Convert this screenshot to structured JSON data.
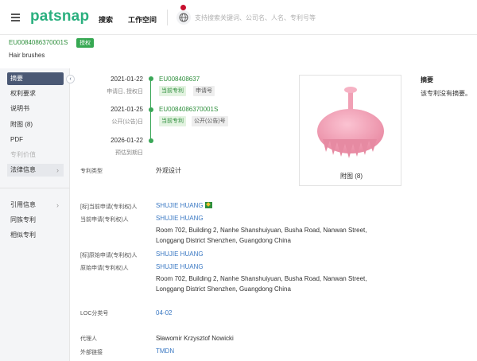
{
  "topbar": {
    "logo": "patsnap",
    "nav": [
      "搜索",
      "工作空间"
    ],
    "search_placeholder": "支持搜索关键词、公司名、人名、专利号等"
  },
  "header": {
    "pub_number": "EU008408637000​1S",
    "status_badge": "授权",
    "title": "Hair brushes"
  },
  "sidebar": {
    "items": [
      {
        "label": "摘要",
        "state": "active"
      },
      {
        "label": "权利要求"
      },
      {
        "label": "说明书"
      },
      {
        "label": "附图 (8)"
      },
      {
        "label": "PDF"
      },
      {
        "label": "专利价值",
        "state": "muted"
      },
      {
        "label": "法律信息",
        "state": "hover"
      }
    ],
    "items2": [
      {
        "label": "引用信息"
      },
      {
        "label": "同族专利"
      },
      {
        "label": "相似专利"
      }
    ]
  },
  "timeline": [
    {
      "date": "2021-01-22",
      "sub": "申请日, 授权日",
      "link": "EU008408637",
      "chips": [
        "当前专利",
        "申请号"
      ]
    },
    {
      "date": "2021-01-25",
      "sub": "公开(公告)日",
      "link": "EU0084086370001S",
      "chips": [
        "当前专利",
        "公开(公告)号"
      ]
    },
    {
      "date": "2026-01-22",
      "sub": "预估到期日"
    }
  ],
  "figure": {
    "label": "附图 (8)",
    "color": "#f2a4b8"
  },
  "abstract": {
    "title": "摘要",
    "text": "该专利没有摘要。"
  },
  "fields": {
    "patent_type": {
      "label": "专利类型",
      "value": "外观设计"
    },
    "std_current_assignee": {
      "label": "[标]当前申请(专利权)人",
      "value": "SHUJIE HUANG"
    },
    "current_assignee": {
      "label": "当前申请(专利权)人",
      "value": "SHUJIE HUANG",
      "addr1": "Room 702, Building 2, Nanhe Shanshuiyuan, Busha Road, Nanwan Street,",
      "addr2": "Longgang District Shenzhen, Guangdong China"
    },
    "std_original_assignee": {
      "label": "[标]原始申请(专利权)人",
      "value": "SHUJIE HUANG"
    },
    "original_assignee": {
      "label": "原始申请(专利权)人",
      "value": "SHUJIE HUANG",
      "addr1": "Room 702, Building 2, Nanhe Shanshuiyuan, Busha Road, Nanwan Street,",
      "addr2": "Longgang District Shenzhen, Guangdong China"
    },
    "loc": {
      "label": "LOC分类号",
      "value": "04-02"
    },
    "agent": {
      "label": "代理人",
      "value": "Sławomir Krzysztof Nowicki"
    },
    "external": {
      "label": "外部链接",
      "value": "TMDN"
    }
  },
  "colors": {
    "brand": "#2bb07f",
    "active_nav": "#4a5874",
    "green": "#3aa757",
    "link_blue": "#3a78c3"
  }
}
